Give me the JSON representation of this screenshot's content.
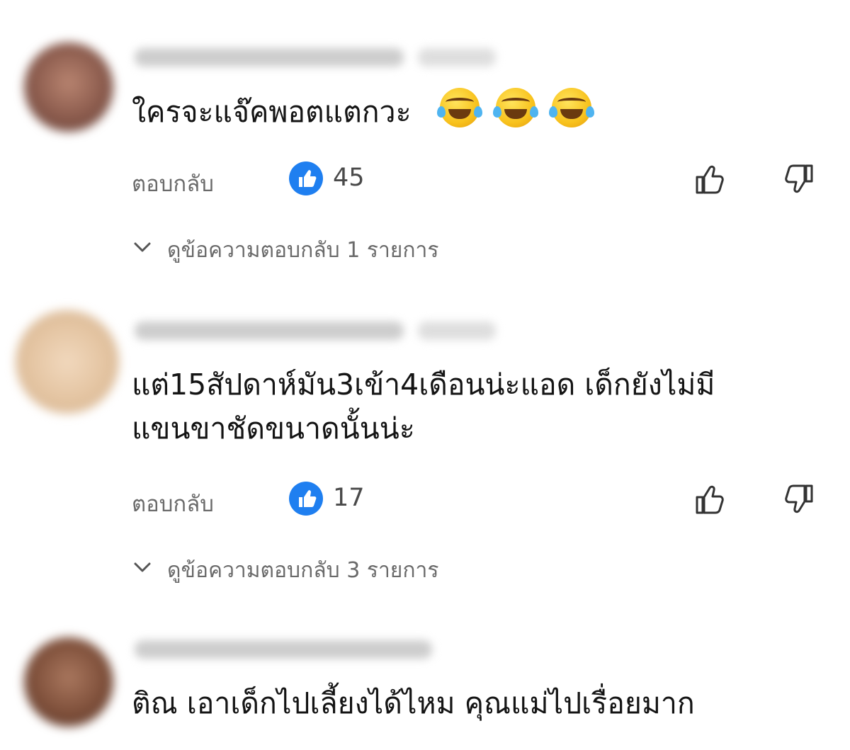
{
  "comments": [
    {
      "text": "ใครจะแจ๊คพอตแตกวะ",
      "emojis": [
        "rolling-on-floor-laughing",
        "rolling-on-floor-laughing",
        "rolling-on-floor-laughing"
      ],
      "reply_label": "ตอบกลับ",
      "like_count": "45",
      "view_replies_label": "ดูข้อความตอบกลับ 1 รายการ"
    },
    {
      "text_lines": [
        "แต่15สัปดาห์มัน3เข้า4เดือนน่ะแอด เด็กยังไม่มี",
        "แขนขาชัดขนาดนั้นน่ะ"
      ],
      "reply_label": "ตอบกลับ",
      "like_count": "17",
      "view_replies_label": "ดูข้อความตอบกลับ 3 รายการ"
    },
    {
      "text": "ติณ เอาเด็กไปเลี้ยงได้ไหม คุณแม่ไปเรื่อยมาก"
    }
  ],
  "colors": {
    "like_badge": "#1f7ff0",
    "secondary_text": "#6a6a6a",
    "primary_text": "#141414"
  }
}
